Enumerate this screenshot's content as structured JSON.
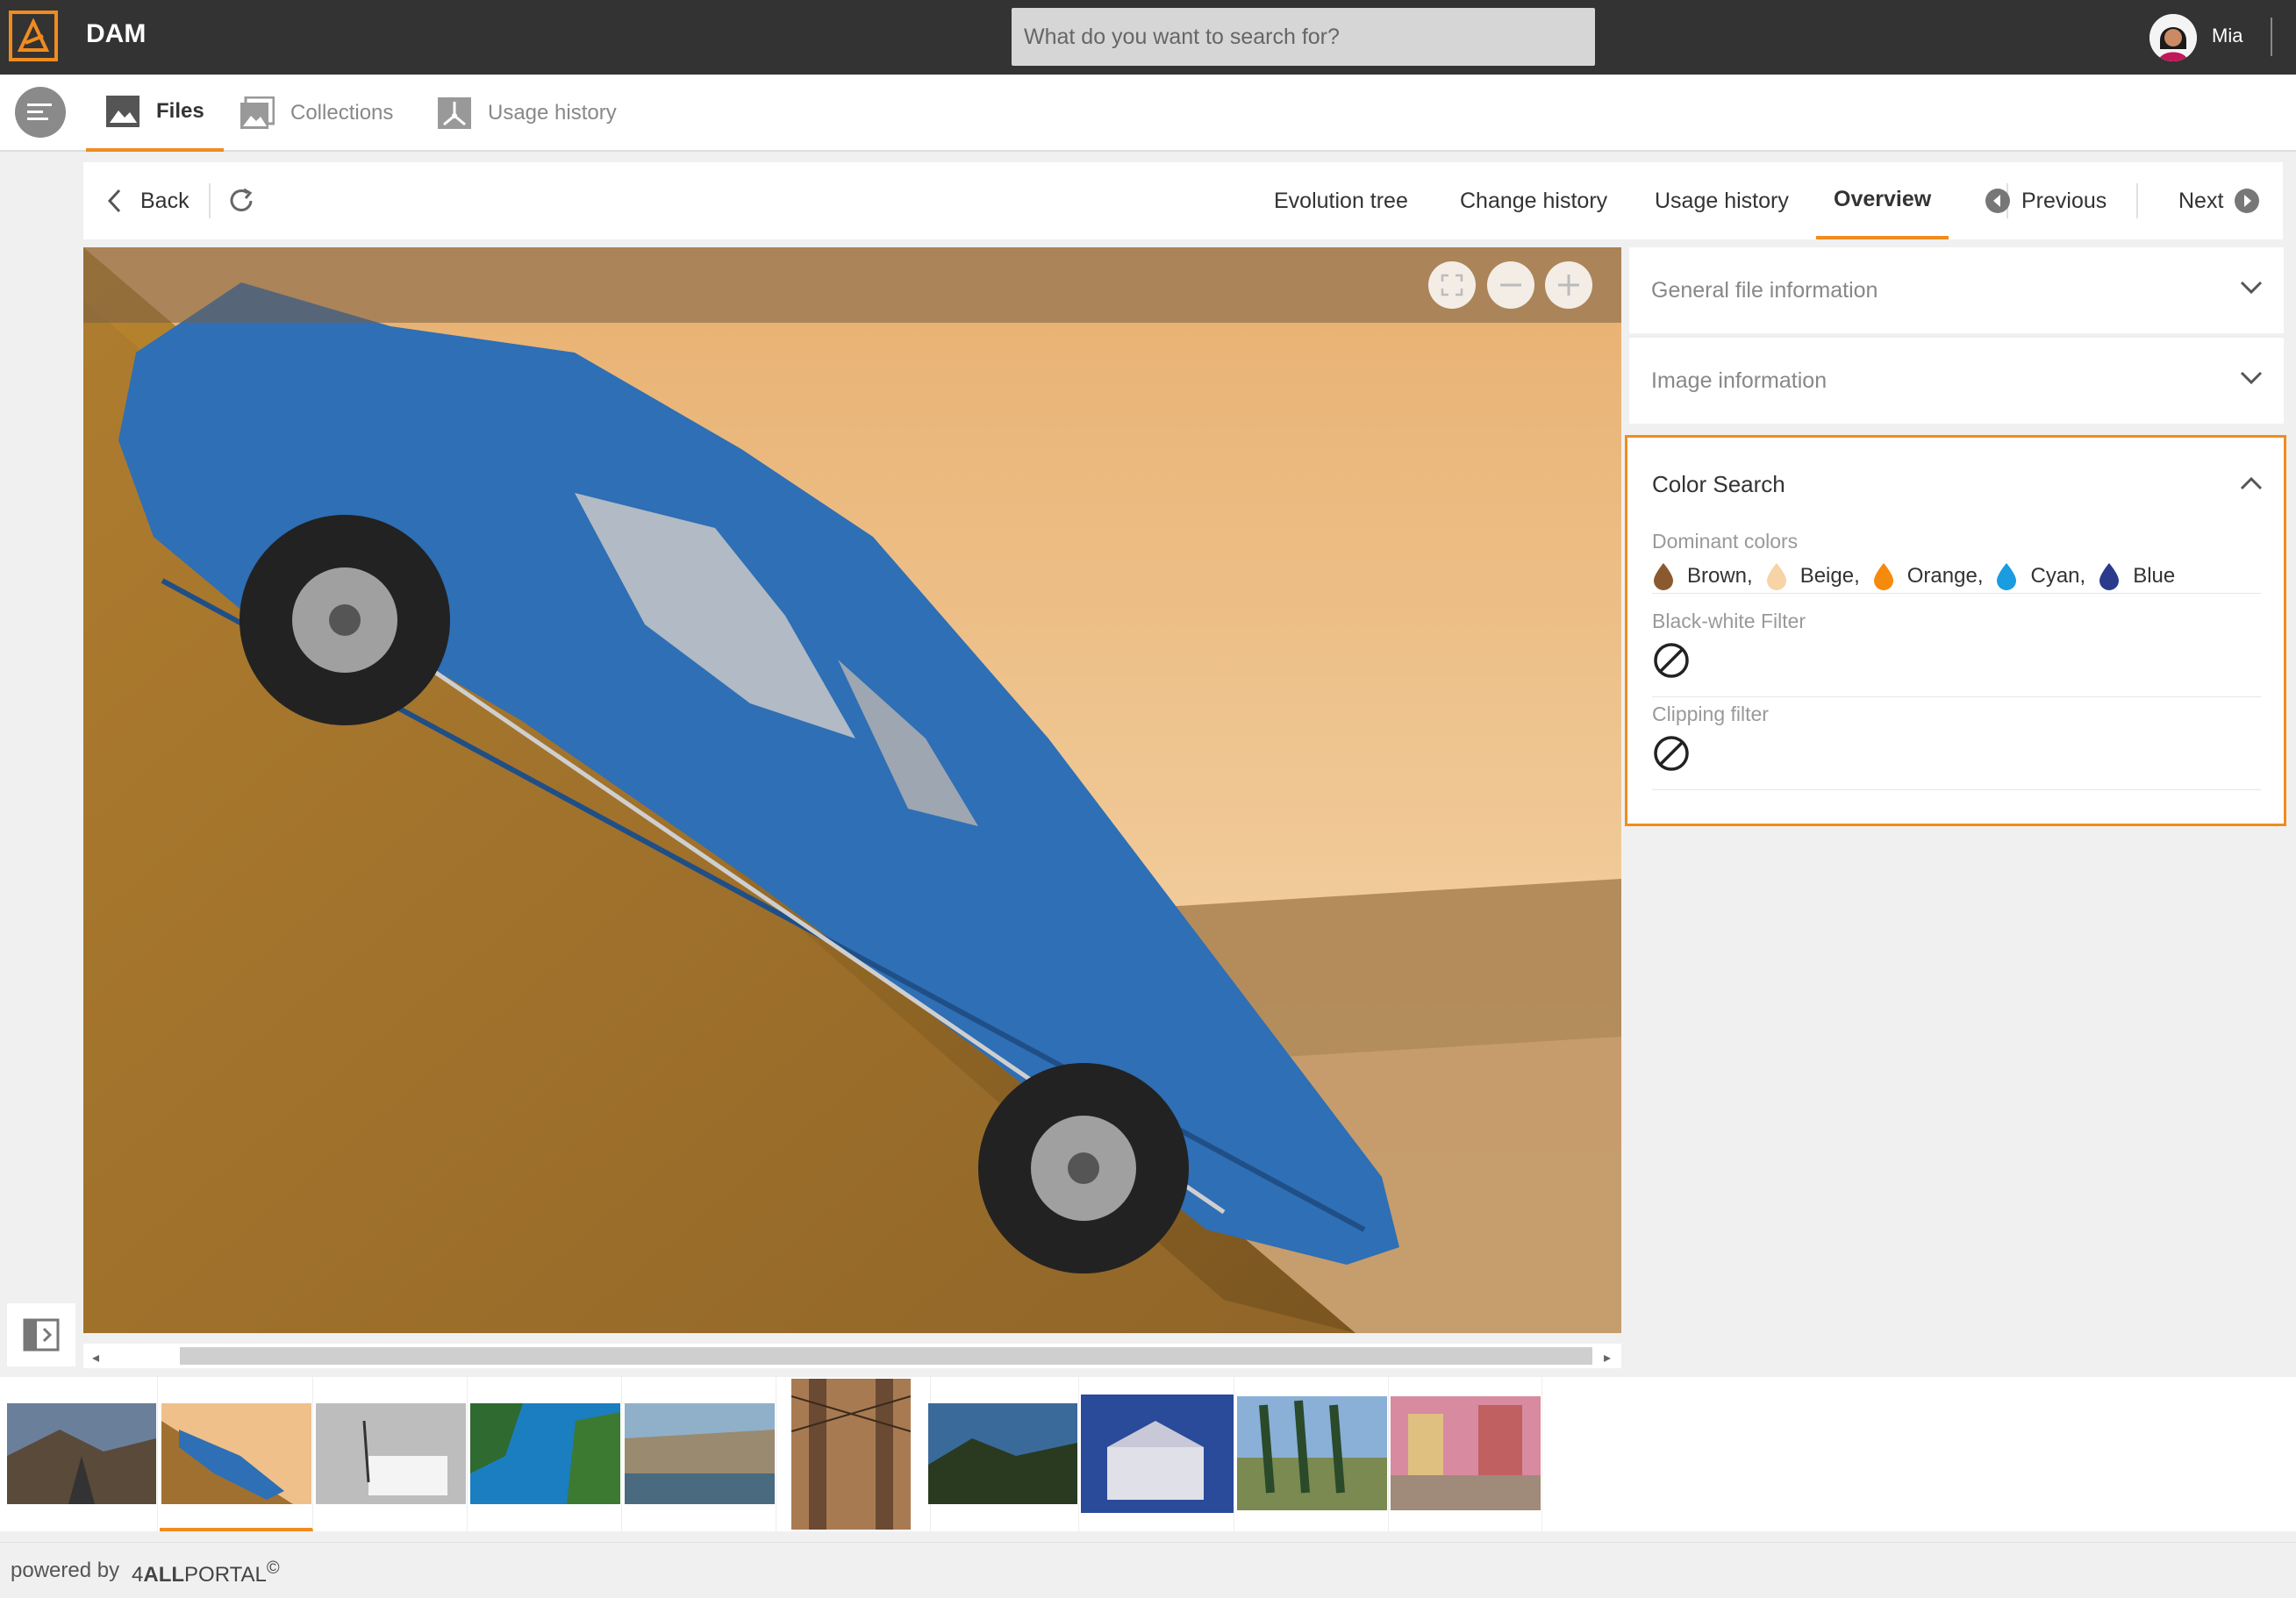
{
  "app": {
    "title": "DAM",
    "brand_color": "#f08c1e"
  },
  "search": {
    "placeholder": "What do you want to search for?"
  },
  "user": {
    "name": "Mia"
  },
  "nav": {
    "tabs": [
      {
        "label": "Files",
        "icon": "image-icon",
        "active": true
      },
      {
        "label": "Collections",
        "icon": "collections-icon",
        "active": false
      },
      {
        "label": "Usage history",
        "icon": "usage-history-icon",
        "active": false
      }
    ]
  },
  "toolbar": {
    "back_label": "Back",
    "evolution_tree": "Evolution tree",
    "change_history": "Change history",
    "usage_history": "Usage history",
    "overview": "Overview",
    "previous": "Previous",
    "next": "Next"
  },
  "panel": {
    "general_file_information": "General file information",
    "image_information": "Image information",
    "color_search": {
      "title": "Color Search",
      "dominant_colors_label": "Dominant colors",
      "colors": [
        {
          "name": "Brown,",
          "hex": "#8a5a2e"
        },
        {
          "name": "Beige,",
          "hex": "#f7d3a6"
        },
        {
          "name": "Orange,",
          "hex": "#f58a0c"
        },
        {
          "name": "Cyan,",
          "hex": "#1a9ce0"
        },
        {
          "name": "Blue",
          "hex": "#2a3a8c"
        }
      ],
      "bw_filter_label": "Black-white Filter",
      "clipping_filter_label": "Clipping filter"
    }
  },
  "footer": {
    "powered_by": "powered by",
    "brand_prefix": "4",
    "brand_bold": "ALL",
    "brand_suffix": "PORTAL",
    "copyright": "©"
  }
}
